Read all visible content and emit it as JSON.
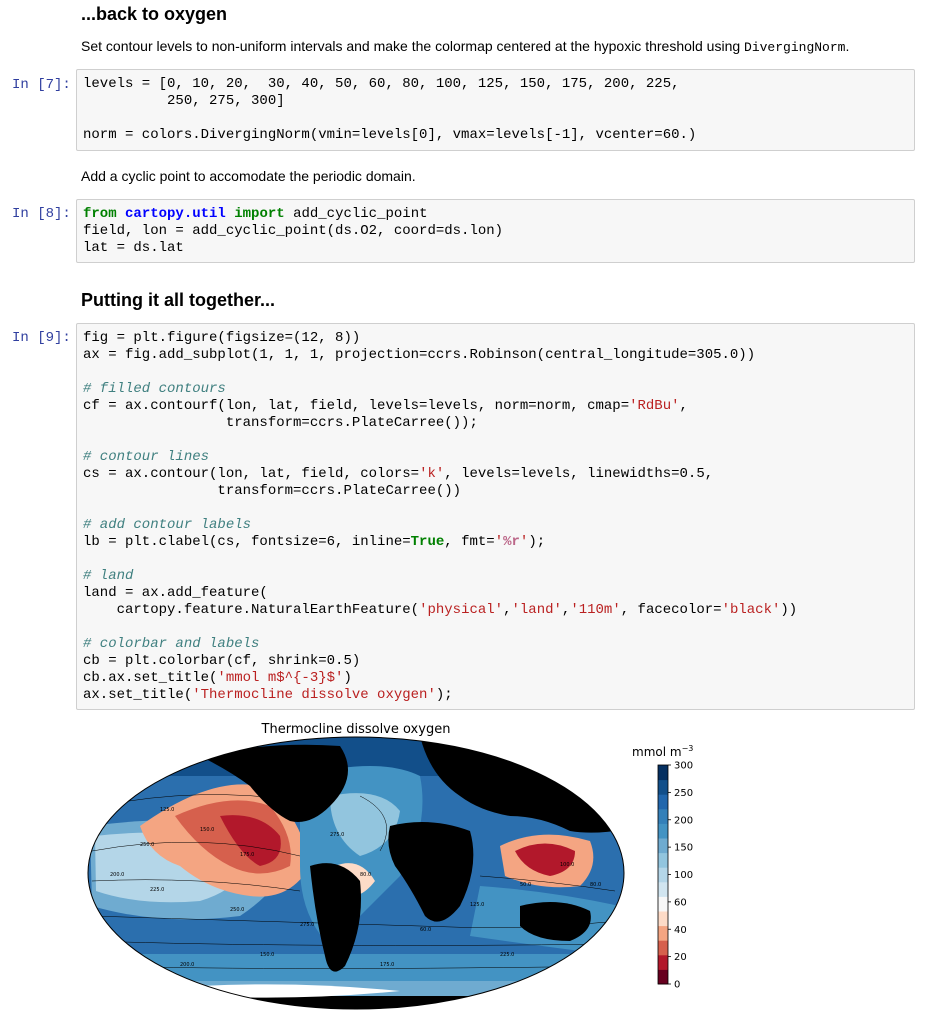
{
  "section1": {
    "heading": "...back to oxygen",
    "para_prefix": "Set contour levels to non-uniform intervals and make the colormap centered at the hypoxic threshold using ",
    "para_code": "DivergingNorm",
    "para_suffix": "."
  },
  "cell7": {
    "prompt": "In [7]:",
    "lines": [
      "levels = [0, 10, 20,  30, 40, 50, 60, 80, 100, 125, 150, 175, 200, 225,",
      "          250, 275, 300]",
      "",
      "norm = colors.DivergingNorm(vmin=levels[0], vmax=levels[-1], vcenter=60.)"
    ]
  },
  "para2": "Add a cyclic point to accomodate the periodic domain.",
  "cell8": {
    "prompt": "In [8]:",
    "line1_kw1": "from",
    "line1_mod": "cartopy.util",
    "line1_kw2": "import",
    "line1_rest": " add_cyclic_point",
    "line2": "field, lon = add_cyclic_point(ds.O2, coord=ds.lon)",
    "line3": "lat = ds.lat"
  },
  "section2": {
    "heading": "Putting it all together..."
  },
  "cell9": {
    "prompt": "In [9]:",
    "l1": "fig = plt.figure(figsize=(12, 8))",
    "l2": "ax = fig.add_subplot(1, 1, 1, projection=ccrs.Robinson(central_longitude=305.0))",
    "c1": "# filled contours",
    "l3a": "cf = ax.contourf(lon, lat, field, levels=levels, norm=norm, cmap=",
    "l3s": "'RdBu'",
    "l3b": ",",
    "l4": "                 transform=ccrs.PlateCarree());",
    "c2": "# contour lines",
    "l5a": "cs = ax.contour(lon, lat, field, colors=",
    "l5s": "'k'",
    "l5b": ", levels=levels, linewidths=0.5,",
    "l6": "                transform=ccrs.PlateCarree())",
    "c3": "# add contour labels",
    "l7a": "lb = plt.clabel(cs, fontsize=6, inline=",
    "l7k": "True",
    "l7b": ", fmt=",
    "l7s1": "'",
    "l7f": "%r",
    "l7s2": "'",
    "l7c": ");",
    "c4": "# land",
    "l8": "land = ax.add_feature(",
    "l9a": "    cartopy.feature.NaturalEarthFeature(",
    "l9s1": "'physical'",
    "l9s2": "'land'",
    "l9s3": "'110m'",
    "l9b": ", facecolor=",
    "l9s4": "'black'",
    "l9c": "))",
    "c5": "# colorbar and labels",
    "l10": "cb = plt.colorbar(cf, shrink=0.5)",
    "l11a": "cb.ax.set_title(",
    "l11s": "'mmol m$^{-3}$'",
    "l11b": ")",
    "l12a": "ax.set_title(",
    "l12s": "'Thermocline dissolve oxygen'",
    "l12b": ");"
  },
  "plot": {
    "title": "Thermocline dissolve oxygen",
    "colorbar_unit": "mmol m",
    "colorbar_unit_sup": "−3",
    "colorbar_ticks": [
      "300",
      "250",
      "200",
      "150",
      "100",
      "60",
      "40",
      "20",
      "0"
    ],
    "colorbar_colors": [
      "#67001f",
      "#b2182b",
      "#d6604d",
      "#f4a582",
      "#fddbc7",
      "#f7f7f7",
      "#d1e5f0",
      "#b4d6e8",
      "#92c5de",
      "#6fabd0",
      "#4393c3",
      "#3480b9",
      "#2166ac",
      "#124f8a",
      "#053061"
    ],
    "contour_labels": [
      "100.0",
      "125.0",
      "150.0",
      "175.0",
      "200.0",
      "225.0",
      "250.0",
      "275.0",
      "80.0",
      "60.0",
      "50.0"
    ]
  }
}
